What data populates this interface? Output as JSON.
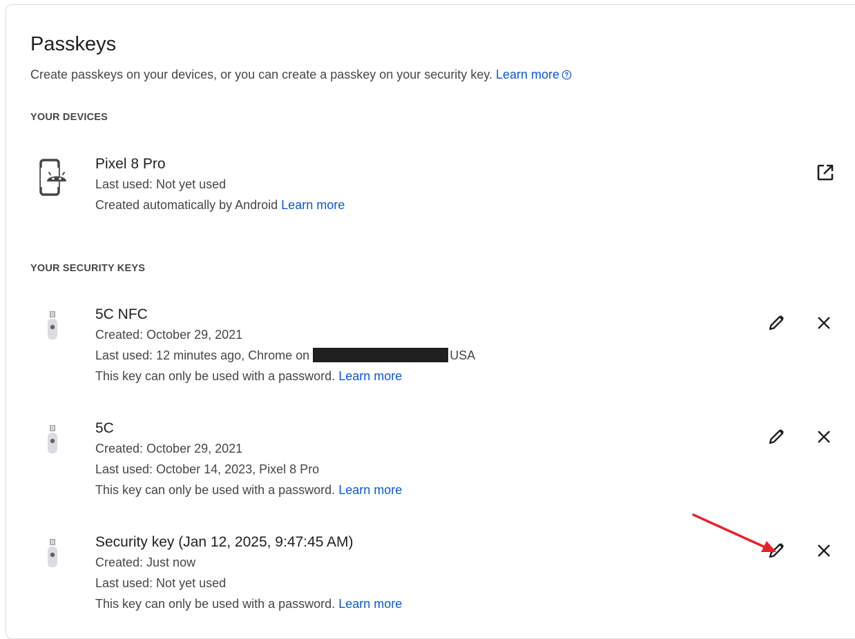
{
  "title": "Passkeys",
  "intro": {
    "text": "Create passkeys on your devices, or you can create a passkey on your security key.",
    "link": "Learn more"
  },
  "devices": {
    "heading": "YOUR DEVICES",
    "items": [
      {
        "name": "Pixel 8 Pro",
        "last_used": "Last used: Not yet used",
        "created": "Created automatically by Android",
        "link": "Learn more"
      }
    ]
  },
  "security_keys": {
    "heading": "YOUR SECURITY KEYS",
    "items": [
      {
        "name": "5C NFC",
        "created": "Created: October 29, 2021",
        "last_used_prefix": "Last used: 12 minutes ago, Chrome on",
        "last_used_suffix": "USA",
        "note": "This key can only be used with a password.",
        "link": "Learn more"
      },
      {
        "name": "5C",
        "created": "Created: October 29, 2021",
        "last_used": "Last used: October 14, 2023, Pixel 8 Pro",
        "note": "This key can only be used with a password.",
        "link": "Learn more"
      },
      {
        "name": "Security key (Jan 12, 2025, 9:47:45 AM)",
        "created": "Created: Just now",
        "last_used": "Last used: Not yet used",
        "note": "This key can only be used with a password.",
        "link": "Learn more"
      }
    ]
  },
  "colors": {
    "link": "#0b57d0",
    "annotation_arrow": "#e8202a"
  },
  "icons": {
    "device": "android-phone-icon",
    "key": "security-key-icon",
    "open": "open-in-new-icon",
    "edit": "pencil-icon",
    "delete": "close-icon",
    "help": "help-circle-icon"
  }
}
